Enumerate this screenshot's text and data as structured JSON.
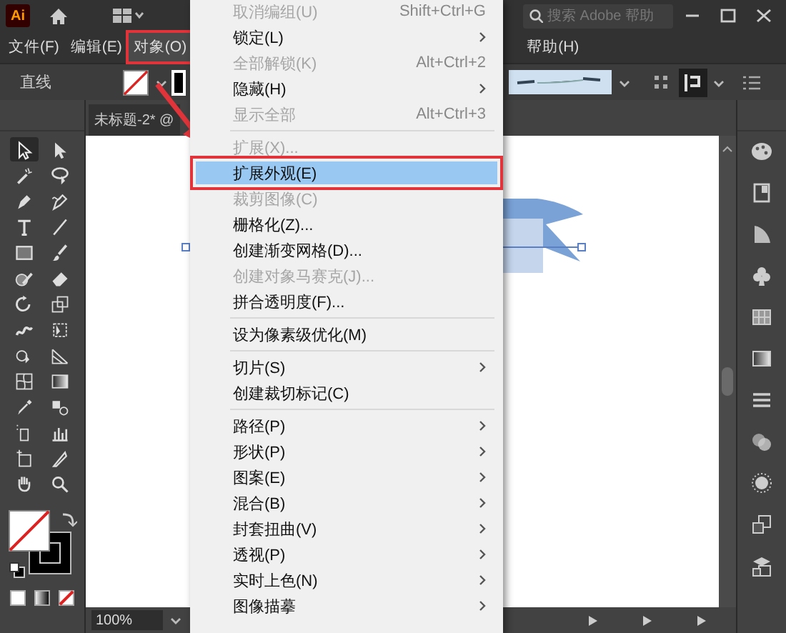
{
  "title_bar": {
    "logo": "Ai",
    "search": {
      "placeholder": "搜索 Adobe 帮助"
    }
  },
  "menu_bar": [
    {
      "label": "文件(F)",
      "selected": false,
      "annotated": false
    },
    {
      "label": "编辑(E)",
      "selected": false,
      "annotated": false
    },
    {
      "label": "对象(O)",
      "selected": true,
      "annotated": true
    },
    {
      "label": "帮助(H)",
      "selected": false,
      "annotated": false
    }
  ],
  "control_bar": {
    "label": "直线"
  },
  "document_tab": {
    "title": "未标题-2* @"
  },
  "tools": [
    {
      "selected": true
    },
    {
      "selected": false
    },
    {
      "selected": false
    },
    {
      "selected": false
    },
    {
      "selected": false
    },
    {
      "selected": false
    },
    {
      "selected": false
    },
    {
      "selected": false
    },
    {
      "selected": false
    },
    {
      "selected": false
    },
    {
      "selected": false
    },
    {
      "selected": false
    },
    {
      "selected": false
    },
    {
      "selected": false
    },
    {
      "selected": false
    },
    {
      "selected": false
    },
    {
      "selected": false
    },
    {
      "selected": false
    },
    {
      "selected": false
    },
    {
      "selected": false
    },
    {
      "selected": false
    },
    {
      "selected": false
    },
    {
      "selected": false
    },
    {
      "selected": false
    },
    {
      "selected": false
    },
    {
      "selected": false
    },
    {
      "selected": false
    },
    {
      "selected": false
    }
  ],
  "status_bar": {
    "zoom": "100%"
  },
  "object_menu": {
    "items": [
      {
        "kind": "item",
        "label": "取消编组(U)",
        "shortcut": "Shift+Ctrl+G",
        "disabled": true,
        "submenu": false,
        "selected": false,
        "annotated": false
      },
      {
        "kind": "item",
        "label": "锁定(L)",
        "disabled": false,
        "submenu": true,
        "selected": false,
        "annotated": false
      },
      {
        "kind": "item",
        "label": "全部解锁(K)",
        "shortcut": "Alt+Ctrl+2",
        "disabled": true,
        "submenu": false,
        "selected": false,
        "annotated": false
      },
      {
        "kind": "item",
        "label": "隐藏(H)",
        "disabled": false,
        "submenu": true,
        "selected": false,
        "annotated": false
      },
      {
        "kind": "item",
        "label": "显示全部",
        "shortcut": "Alt+Ctrl+3",
        "disabled": true,
        "submenu": false,
        "selected": false,
        "annotated": false
      },
      {
        "kind": "separator"
      },
      {
        "kind": "item",
        "label": "扩展(X)...",
        "disabled": true,
        "submenu": false,
        "selected": false,
        "annotated": false
      },
      {
        "kind": "item",
        "label": "扩展外观(E)",
        "disabled": false,
        "submenu": false,
        "selected": true,
        "annotated": true
      },
      {
        "kind": "item",
        "label": "裁剪图像(C)",
        "disabled": true,
        "submenu": false,
        "selected": false,
        "annotated": false
      },
      {
        "kind": "item",
        "label": "栅格化(Z)...",
        "disabled": false,
        "submenu": false,
        "selected": false,
        "annotated": false
      },
      {
        "kind": "item",
        "label": "创建渐变网格(D)...",
        "disabled": false,
        "submenu": false,
        "selected": false,
        "annotated": false
      },
      {
        "kind": "item",
        "label": "创建对象马赛克(J)...",
        "disabled": true,
        "submenu": false,
        "selected": false,
        "annotated": false
      },
      {
        "kind": "item",
        "label": "拼合透明度(F)...",
        "disabled": false,
        "submenu": false,
        "selected": false,
        "annotated": false
      },
      {
        "kind": "separator"
      },
      {
        "kind": "item",
        "label": "设为像素级优化(M)",
        "disabled": false,
        "submenu": false,
        "selected": false,
        "annotated": false
      },
      {
        "kind": "separator"
      },
      {
        "kind": "item",
        "label": "切片(S)",
        "disabled": false,
        "submenu": true,
        "selected": false,
        "annotated": false
      },
      {
        "kind": "item",
        "label": "创建裁切标记(C)",
        "disabled": false,
        "submenu": false,
        "selected": false,
        "annotated": false
      },
      {
        "kind": "separator"
      },
      {
        "kind": "item",
        "label": "路径(P)",
        "disabled": false,
        "submenu": true,
        "selected": false,
        "annotated": false
      },
      {
        "kind": "item",
        "label": "形状(P)",
        "disabled": false,
        "submenu": true,
        "selected": false,
        "annotated": false
      },
      {
        "kind": "item",
        "label": "图案(E)",
        "disabled": false,
        "submenu": true,
        "selected": false,
        "annotated": false
      },
      {
        "kind": "item",
        "label": "混合(B)",
        "disabled": false,
        "submenu": true,
        "selected": false,
        "annotated": false
      },
      {
        "kind": "item",
        "label": "封套扭曲(V)",
        "disabled": false,
        "submenu": true,
        "selected": false,
        "annotated": false
      },
      {
        "kind": "item",
        "label": "透视(P)",
        "disabled": false,
        "submenu": true,
        "selected": false,
        "annotated": false
      },
      {
        "kind": "item",
        "label": "实时上色(N)",
        "disabled": false,
        "submenu": true,
        "selected": false,
        "annotated": false
      },
      {
        "kind": "item",
        "label": "图像描摹",
        "disabled": false,
        "submenu": true,
        "selected": false,
        "annotated": false
      }
    ]
  }
}
